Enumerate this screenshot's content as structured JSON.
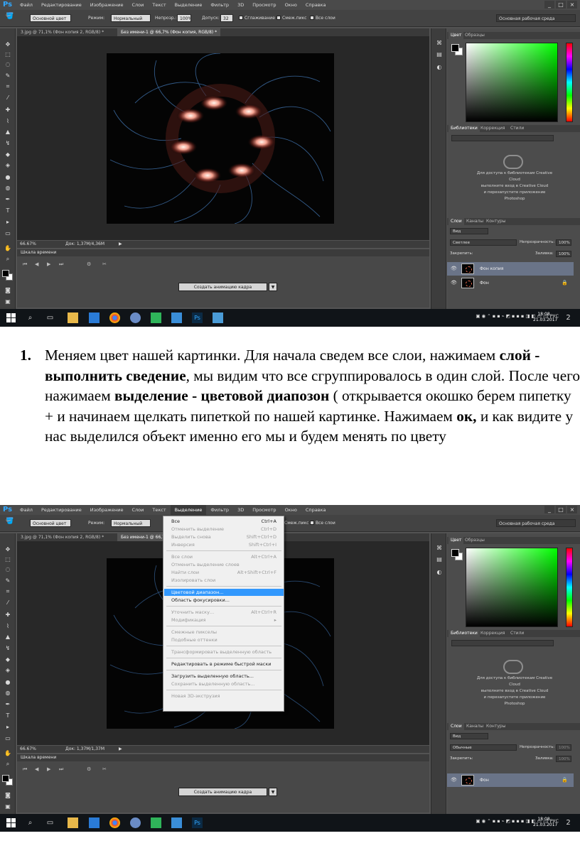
{
  "ps_menu": [
    "Файл",
    "Редактирование",
    "Изображение",
    "Слои",
    "Текст",
    "Выделение",
    "Фильтр",
    "3D",
    "Просмотр",
    "Окно",
    "Справка"
  ],
  "window_controls": {
    "minimize": "_",
    "maximize": "□",
    "close": "×"
  },
  "options_bar": {
    "sample_mode": "Основной цвет",
    "mode_label": "Режим:",
    "mode_value": "Нормальный",
    "opacity_label": "Непрозр.:",
    "opacity_value": "100%",
    "tolerance_label": "Допуск:",
    "tolerance_value": "32",
    "antialias_label": "Сглаживание",
    "contiguous_label": "Смеж.пикс",
    "all_layers_label": "Все слои",
    "workspace": "Основная рабочая среда"
  },
  "doc_tabs": {
    "tab1": "3.jpg @ 71,1% (Фон копия 2, RGB/8) *",
    "tab2": "Без имени-1 @ 66,7% (Фон копия, RGB/8) *",
    "tab2_alt": "Без имени-1 @ 66,7% (Фон копия, RGB/8) *"
  },
  "status": {
    "zoom": "66.67%",
    "doc1": "Док: 1,37M/4,36M",
    "doc2": "Док: 1,37M/1,37M"
  },
  "timeline": {
    "title": "Шкала времени",
    "create_button": "Создать анимацию кадра"
  },
  "color_panel": {
    "tab_color": "Цвет",
    "tab_swatches": "Образцы"
  },
  "libraries_panel": {
    "tab_libraries": "Библиотеки",
    "tab_adjustments": "Коррекция",
    "tab_styles": "Стили",
    "message": [
      "Для доступа к библиотекам Creative",
      "Cloud",
      "выполните вход в Creative Cloud",
      "и перезапустите приложение",
      "Photoshop"
    ]
  },
  "layers_panel": {
    "tab_layers": "Слои",
    "tab_channels": "Каналы",
    "tab_paths": "Контуры",
    "kind": "Вид",
    "blend_mode": "Светлее",
    "blend_mode_2": "Обычные",
    "opacity_label": "Непрозрачность:",
    "opacity_value": "100%",
    "lock_label": "Закрепить:",
    "fill_label": "Заливка:",
    "fill_value": "100%",
    "layers_1": [
      {
        "name": "Фон копия"
      },
      {
        "name": "Фон"
      }
    ],
    "layers_2": [
      {
        "name": "Фон"
      }
    ]
  },
  "taskbar": {
    "language": "РУС",
    "time": "18:08",
    "date": "21.03.2017",
    "notifications": "2"
  },
  "select_menu": {
    "title": "Выделение",
    "items": [
      {
        "label": "Все",
        "shortcut": "Ctrl+A",
        "disabled": false
      },
      {
        "label": "Отменить выделение",
        "shortcut": "Ctrl+D",
        "disabled": true
      },
      {
        "label": "Выделить снова",
        "shortcut": "Shift+Ctrl+D",
        "disabled": true
      },
      {
        "label": "Инверсия",
        "shortcut": "Shift+Ctrl+I",
        "disabled": true
      },
      {
        "label": "Все слои",
        "shortcut": "Alt+Ctrl+A",
        "disabled": true
      },
      {
        "label": "Отменить выделение слоев",
        "shortcut": "",
        "disabled": true
      },
      {
        "label": "Найти слои",
        "shortcut": "Alt+Shift+Ctrl+F",
        "disabled": true
      },
      {
        "label": "Изолировать слои",
        "shortcut": "",
        "disabled": true
      },
      {
        "label": "Цветовой диапазон...",
        "shortcut": "",
        "disabled": false
      },
      {
        "label": "Область фокусировки...",
        "shortcut": "",
        "disabled": false
      },
      {
        "label": "Уточнить маску...",
        "shortcut": "Alt+Ctrl+R",
        "disabled": true
      },
      {
        "label": "Модификация",
        "shortcut": "▸",
        "disabled": true
      },
      {
        "label": "Смежные пикселы",
        "shortcut": "",
        "disabled": true
      },
      {
        "label": "Подобные оттенки",
        "shortcut": "",
        "disabled": true
      },
      {
        "label": "Трансформировать выделенную область",
        "shortcut": "",
        "disabled": true
      },
      {
        "label": "Редактировать в режиме быстрой маски",
        "shortcut": "",
        "disabled": false
      },
      {
        "label": "Загрузить выделенную область...",
        "shortcut": "",
        "disabled": false
      },
      {
        "label": "Сохранить выделенную область...",
        "shortcut": "",
        "disabled": true
      },
      {
        "label": "Новая 3D-экструзия",
        "shortcut": "",
        "disabled": true
      }
    ]
  },
  "instruction": {
    "number": "1.",
    "t1": "Меняем цвет нашей картинки. Для начала сведем все слои, нажимаем ",
    "b1": "слой - выполнить сведение",
    "t2": ", мы видим что все сгруппировалось в один слой. После чего нажимаем ",
    "b2": "выделение - цветовой диапозон",
    "t3": " ( открывается окошко берем пипетку + и начинаем щелкать пипеткой по нашей картинке. Нажимаем ",
    "b3": "ок,",
    "t4": " и как видите у нас выделился объект именно его мы и будем менять по цвету"
  }
}
